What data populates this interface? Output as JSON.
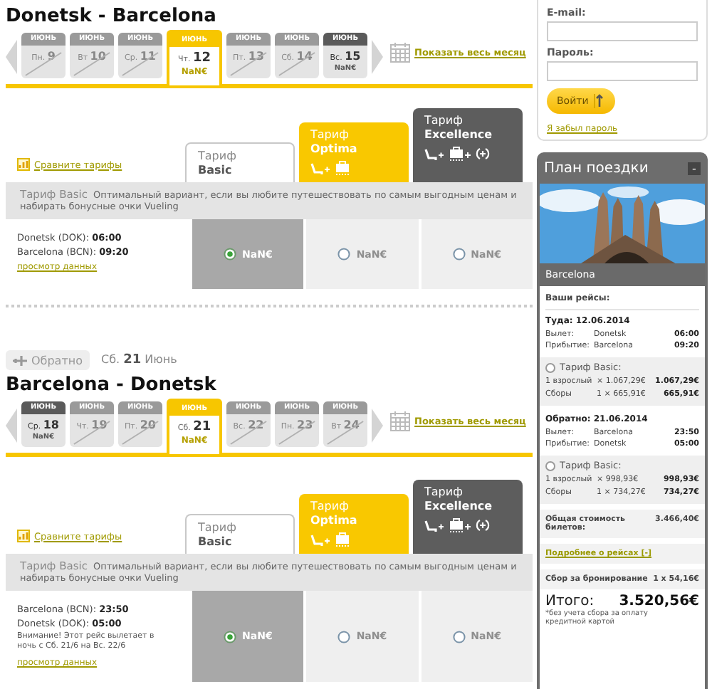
{
  "outbound": {
    "title": "Donetsk - Barcelona",
    "days": [
      {
        "month": "ИЮНЬ",
        "weekday": "Пн.",
        "day": "9",
        "available": false,
        "selected": false
      },
      {
        "month": "ИЮНЬ",
        "weekday": "Вт",
        "day": "10",
        "available": false,
        "selected": false
      },
      {
        "month": "ИЮНЬ",
        "weekday": "Ср.",
        "day": "11",
        "available": false,
        "selected": false
      },
      {
        "month": "ИЮНЬ",
        "weekday": "Чт.",
        "day": "12",
        "price": "NaN€",
        "available": true,
        "selected": true
      },
      {
        "month": "ИЮНЬ",
        "weekday": "Пт.",
        "day": "13",
        "available": false,
        "selected": false
      },
      {
        "month": "ИЮНЬ",
        "weekday": "Сб.",
        "day": "14",
        "available": false,
        "selected": false
      },
      {
        "month": "ИЮНЬ",
        "weekday": "Вс.",
        "day": "15",
        "price": "NaN€",
        "available": true,
        "selected": false
      }
    ],
    "show_month": "Показать весь месяц",
    "compare_link": "Сравните тарифы",
    "tariffs": [
      {
        "kind": "basic",
        "label": "Тариф",
        "name": "Basic",
        "selected": true
      },
      {
        "kind": "optima",
        "label": "Тариф",
        "name": "Optima",
        "selected": false
      },
      {
        "kind": "excellence",
        "label": "Тариф",
        "name": "Excellence",
        "selected": false
      }
    ],
    "description": {
      "title": "Тариф Basic",
      "text": "Оптимальный вариант, если вы любите путешествовать по самым выгодным ценам и набирать бонусные очки Vueling"
    },
    "flight": {
      "lines": [
        "Donetsk (DOK): **06:00**",
        "Barcelona (BCN): **09:20**"
      ],
      "details_link": "просмотр данных",
      "prices": [
        {
          "price": "NaN€",
          "selected": true
        },
        {
          "price": "NaN€",
          "selected": false
        },
        {
          "price": "NaN€",
          "selected": false
        }
      ]
    }
  },
  "return_bar": {
    "button": "Обратно",
    "date": "Сб. **21** Июнь"
  },
  "inbound": {
    "title": "Barcelona - Donetsk",
    "days": [
      {
        "month": "ИЮНЬ",
        "weekday": "Ср.",
        "day": "18",
        "price": "NaN€",
        "available": true,
        "selected": false
      },
      {
        "month": "ИЮНЬ",
        "weekday": "Чт.",
        "day": "19",
        "available": false,
        "selected": false
      },
      {
        "month": "ИЮНЬ",
        "weekday": "Пт.",
        "day": "20",
        "available": false,
        "selected": false
      },
      {
        "month": "ИЮНЬ",
        "weekday": "Сб.",
        "day": "21",
        "price": "NaN€",
        "available": true,
        "selected": true
      },
      {
        "month": "ИЮНЬ",
        "weekday": "Вс.",
        "day": "22",
        "available": false,
        "selected": false
      },
      {
        "month": "ИЮНЬ",
        "weekday": "Пн.",
        "day": "23",
        "available": false,
        "selected": false
      },
      {
        "month": "ИЮНЬ",
        "weekday": "Вт",
        "day": "24",
        "available": false,
        "selected": false
      }
    ],
    "show_month": "Показать весь месяц",
    "compare_link": "Сравните тарифы",
    "tariffs": [
      {
        "kind": "basic",
        "label": "Тариф",
        "name": "Basic",
        "selected": true
      },
      {
        "kind": "optima",
        "label": "Тариф",
        "name": "Optima",
        "selected": false
      },
      {
        "kind": "excellence",
        "label": "Тариф",
        "name": "Excellence",
        "selected": false
      }
    ],
    "description": {
      "title": "Тариф Basic",
      "text": "Оптимальный вариант, если вы любите путешествовать по самым выгодным ценам и набирать бонусные очки Vueling"
    },
    "flight": {
      "lines": [
        "Barcelona (BCN): **23:50**",
        "Donetsk (DOK): **05:00**"
      ],
      "note": "Внимание! Этот рейс вылетает в ночь с Сб. 21/6 на Вс. 22/6",
      "details_link": "просмотр данных",
      "prices": [
        {
          "price": "NaN€",
          "selected": true
        },
        {
          "price": "NaN€",
          "selected": false
        },
        {
          "price": "NaN€",
          "selected": false
        }
      ]
    }
  },
  "login": {
    "email_label": "E-mail:",
    "password_label": "Пароль:",
    "button": "Войти",
    "forgot_link": "Я забыл пароль"
  },
  "trip_plan": {
    "title": "План поездки",
    "collapse": "-",
    "photo_caption": "Barcelona",
    "flights_heading": "Ваши рейсы:",
    "legs": [
      {
        "heading": "Туда: 12.06.2014",
        "rows": [
          {
            "label": "Вылет:",
            "city": "Donetsk",
            "time": "06:00"
          },
          {
            "label": "Прибытие:",
            "city": "Barcelona",
            "time": "09:20"
          }
        ],
        "tariff": "Тариф Basic:",
        "tariff_selected": false,
        "charges": [
          {
            "label": "1 взрослый",
            "calc": "× 1.067,29€",
            "amount": "1.067,29€"
          },
          {
            "label": "Сборы",
            "calc": "1 × 665,91€",
            "amount": "665,91€"
          }
        ]
      },
      {
        "heading": "Обратно: 21.06.2014",
        "rows": [
          {
            "label": "Вылет:",
            "city": "Barcelona",
            "time": "23:50"
          },
          {
            "label": "Прибытие:",
            "city": "Donetsk",
            "time": "05:00"
          }
        ],
        "tariff": "Тариф Basic:",
        "tariff_selected": false,
        "charges": [
          {
            "label": "1 взрослый",
            "calc": "× 998,93€",
            "amount": "998,93€"
          },
          {
            "label": "Сборы",
            "calc": "1 × 734,27€",
            "amount": "734,27€"
          }
        ]
      }
    ],
    "total_label": "Общая стоимость билетов:",
    "total": "3.466,40€",
    "details_link": "Подробнее о рейсах [-]",
    "fee_label": "Сбор за бронирование",
    "fee": "1 x 54,16€",
    "grand_label": "Итого:",
    "grand_total": "3.520,56€",
    "note": "*без учета сбора за оплату кредитной картой"
  }
}
